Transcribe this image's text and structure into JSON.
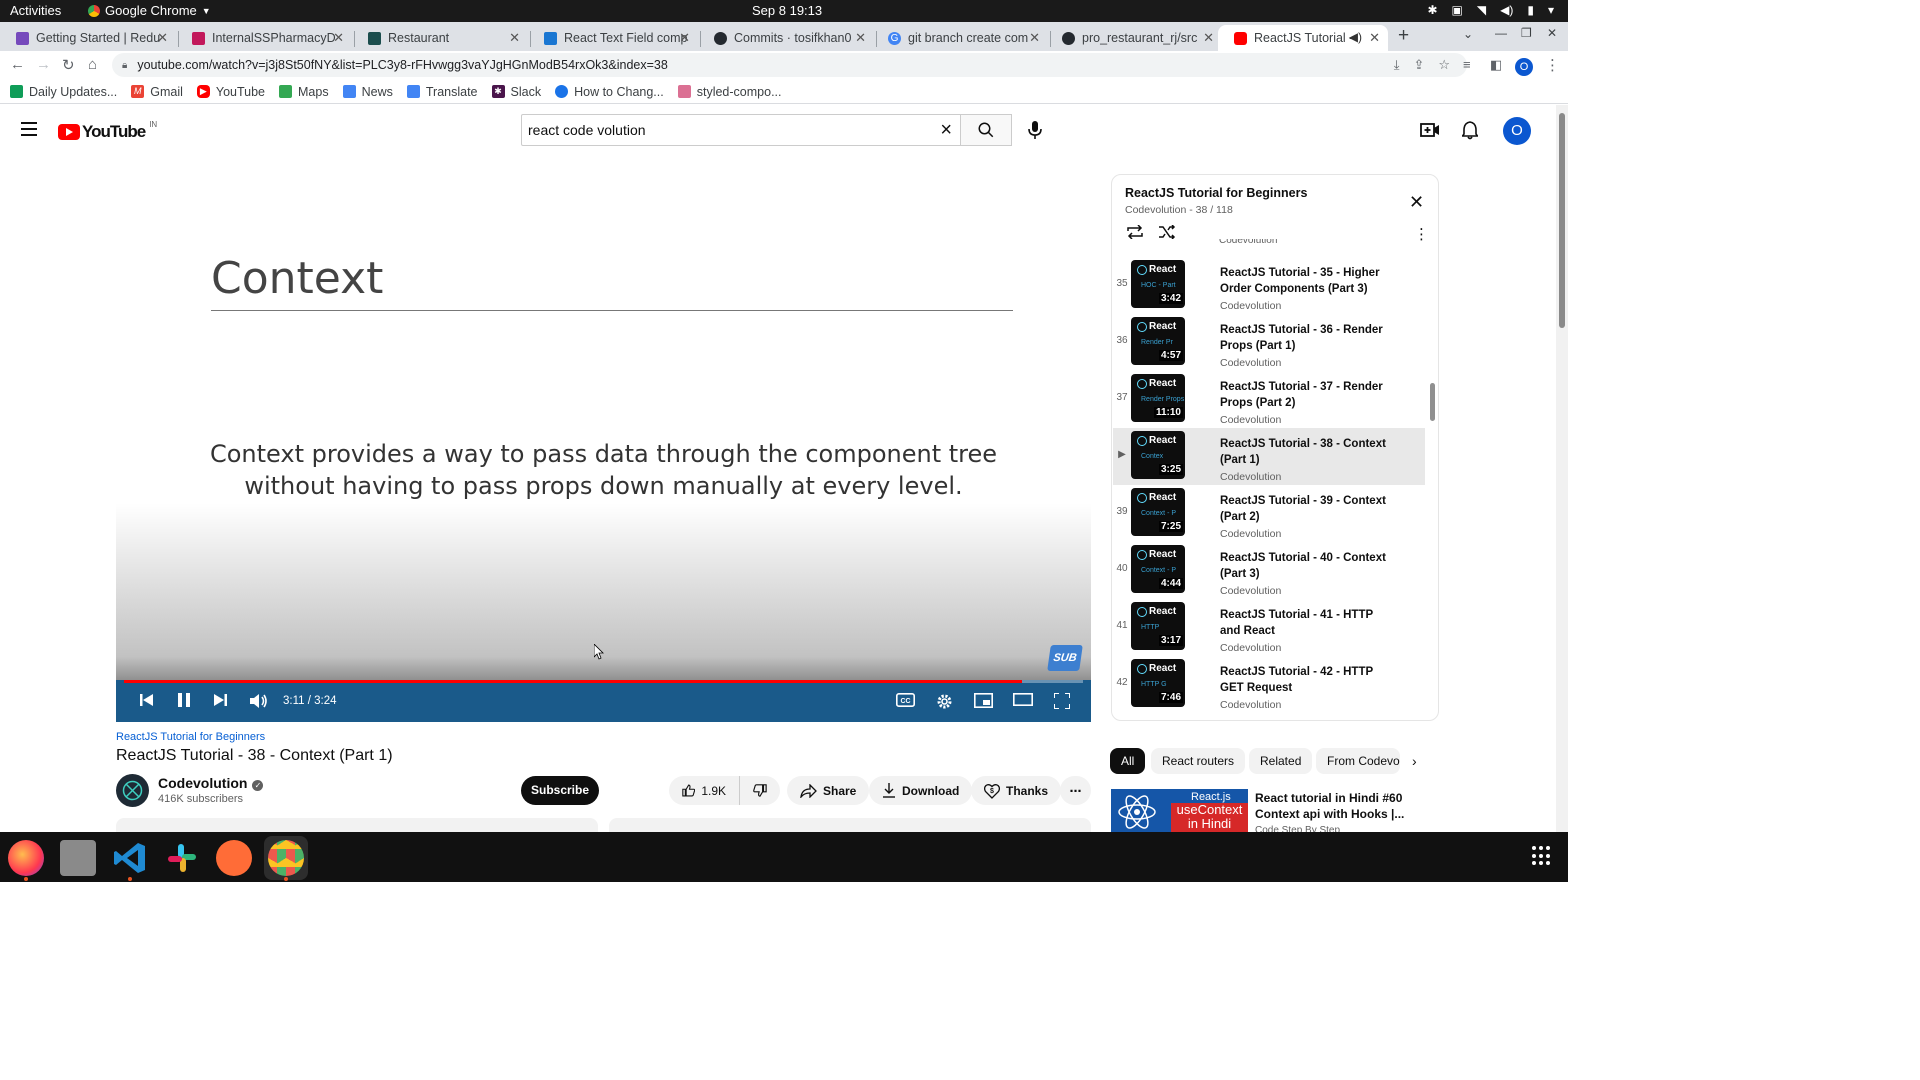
{
  "os": {
    "activities": "Activities",
    "app_name": "Google Chrome",
    "clock": "Sep 8  19:13"
  },
  "tabs": [
    {
      "title": "Getting Started | Redu",
      "favicon_color": "#764abc"
    },
    {
      "title": "InternalSSPharmacyD",
      "favicon_color": "#c2185b"
    },
    {
      "title": "Restaurant",
      "favicon_color": "#1b4d4d"
    },
    {
      "title": "React Text Field comp",
      "favicon_color": "#1976d2"
    },
    {
      "title": "Commits · tosifkhan0",
      "favicon_color": "#24292f"
    },
    {
      "title": "git branch create com",
      "favicon_color": "#4285f4"
    },
    {
      "title": "pro_restaurant_rj/src",
      "favicon_color": "#24292f"
    },
    {
      "title": "ReactJS Tutorial -",
      "favicon_color": "#ff0000",
      "active": true
    }
  ],
  "address": {
    "url": "youtube.com/watch?v=j3j8St50fNY&list=PLC3y8-rFHvwgg3vaYJgHGnModB54rxOk3&index=38"
  },
  "bookmarks": [
    {
      "label": "Daily Updates...",
      "color": "#0f9d58"
    },
    {
      "label": "Gmail",
      "color": "#ea4335"
    },
    {
      "label": "YouTube",
      "color": "#ff0000"
    },
    {
      "label": "Maps",
      "color": "#34a853"
    },
    {
      "label": "News",
      "color": "#4285f4"
    },
    {
      "label": "Translate",
      "color": "#4285f4"
    },
    {
      "label": "Slack",
      "color": "#4a154b"
    },
    {
      "label": "How to Chang...",
      "color": "#1a73e8"
    },
    {
      "label": "styled-compo...",
      "color": "#db7093"
    }
  ],
  "youtube": {
    "logo_text": "YouTube",
    "country": "IN",
    "search_value": "react code volution",
    "avatar_letter": "O"
  },
  "player": {
    "slide_title": "Context",
    "slide_body": "Context provides a way to pass data through the component tree without having to pass props down manually at every level.",
    "time": "3:11 / 3:24",
    "progress": 0.936,
    "sub_badge": "SUB"
  },
  "video": {
    "playlist_link": "ReactJS Tutorial for Beginners",
    "title": "ReactJS Tutorial - 38 - Context (Part 1)",
    "channel": "Codevolution",
    "subscribers": "416K subscribers",
    "subscribe_label": "Subscribe",
    "likes": "1.9K",
    "share_label": "Share",
    "download_label": "Download",
    "thanks_label": "Thanks"
  },
  "playlist": {
    "title": "ReactJS Tutorial for Beginners",
    "meta": "Codevolution - 38 / 118",
    "items": [
      {
        "idx": "35",
        "title": "ReactJS Tutorial - 35 - Higher Order Components (Part 3)",
        "channel": "Codevolution",
        "duration": "3:42",
        "thumb_label": "HOC - Part",
        "thumb_badge": "React"
      },
      {
        "idx": "36",
        "title": "ReactJS Tutorial - 36 - Render Props (Part 1)",
        "channel": "Codevolution",
        "duration": "4:57",
        "thumb_label": "Render Pr",
        "thumb_badge": "React"
      },
      {
        "idx": "37",
        "title": "ReactJS Tutorial - 37 - Render Props (Part 2)",
        "channel": "Codevolution",
        "duration": "11:10",
        "thumb_label": "Render Props",
        "thumb_badge": "React"
      },
      {
        "idx": "▶",
        "title": "ReactJS Tutorial - 38 - Context (Part 1)",
        "channel": "Codevolution",
        "duration": "3:25",
        "thumb_label": "Contex",
        "thumb_badge": "React",
        "current": true
      },
      {
        "idx": "39",
        "title": "ReactJS Tutorial - 39 - Context (Part 2)",
        "channel": "Codevolution",
        "duration": "7:25",
        "thumb_label": "Context - P",
        "thumb_badge": "React"
      },
      {
        "idx": "40",
        "title": "ReactJS Tutorial - 40 - Context (Part 3)",
        "channel": "Codevolution",
        "duration": "4:44",
        "thumb_label": "Context - P",
        "thumb_badge": "React"
      },
      {
        "idx": "41",
        "title": "ReactJS Tutorial - 41 - HTTP and React",
        "channel": "Codevolution",
        "duration": "3:17",
        "thumb_label": "HTTP",
        "thumb_badge": "React"
      },
      {
        "idx": "42",
        "title": "ReactJS Tutorial - 42 - HTTP GET Request",
        "channel": "Codevolution",
        "duration": "7:46",
        "thumb_label": "HTTP G",
        "thumb_badge": "React"
      }
    ]
  },
  "chips": [
    "All",
    "React routers",
    "Related",
    "From Codevo"
  ],
  "recommendation": {
    "thumb_top": "React.js",
    "thumb_main": "useContext in Hindi",
    "title": "React tutorial in Hindi #60 Context api with Hooks |...",
    "channel": "Code Step By Step"
  },
  "dock": [
    {
      "name": "firefox",
      "color": "#e66000"
    },
    {
      "name": "files",
      "color": "#7d7d7d"
    },
    {
      "name": "vscode",
      "color": "#1f6fbf"
    },
    {
      "name": "slack",
      "color": "#ffffff"
    },
    {
      "name": "postman",
      "color": "#ff6c37"
    },
    {
      "name": "chrome",
      "color": "#dddddd"
    }
  ]
}
